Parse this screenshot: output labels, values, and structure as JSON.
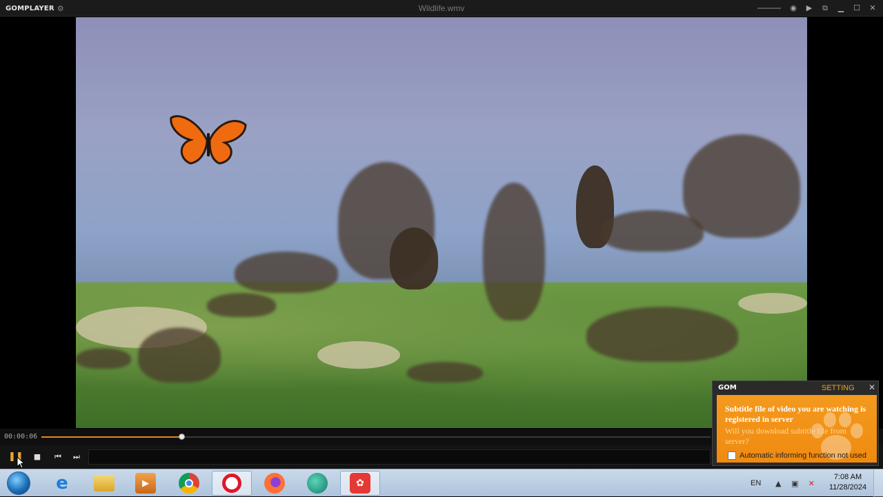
{
  "app": {
    "brand": "GOMPLAYER",
    "title": "Wildlife.wmv"
  },
  "icons": {
    "settings": "gear-icon",
    "volume": "speaker-icon",
    "play": "play-icon",
    "restore": "restore-icon",
    "minimize": "minimize-icon",
    "maximize": "maximize-icon",
    "close": "close-icon"
  },
  "playback": {
    "elapsed": "00:00:06",
    "progress_fraction": 0.21
  },
  "popup": {
    "brand": "GOM",
    "setting_label": "SETTING",
    "message": "Subtitle file of video you are watching is registered in server",
    "question": "Will you download subtitle file from server?",
    "checkbox_label": "Automatic informing function not used"
  },
  "taskbar": {
    "apps": [
      "internet-explorer",
      "file-explorer",
      "media-player",
      "chrome",
      "opera",
      "firefox",
      "app-7",
      "gom-player"
    ],
    "language": "EN",
    "time": "7:08 AM",
    "date": "11/28/2024"
  },
  "colors": {
    "accent": "#e58a1e",
    "popup_orange": "#f39a1e",
    "setting_orange": "#f0a020"
  }
}
